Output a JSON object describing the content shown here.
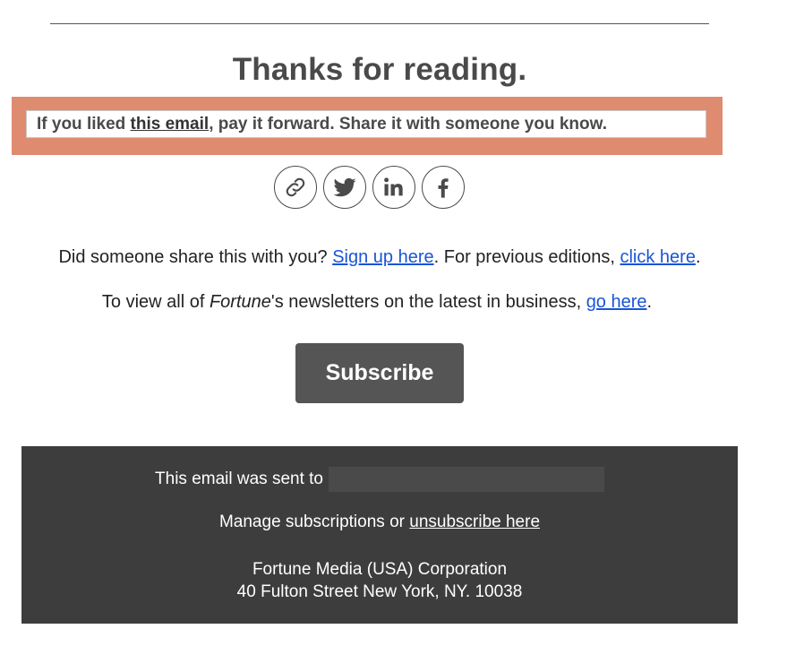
{
  "heading": "Thanks for reading.",
  "share_prompt": {
    "prefix": "If you liked ",
    "link": "this email",
    "suffix": ", pay it forward. Share it with someone you know."
  },
  "social_buttons": [
    {
      "icon": "link-icon"
    },
    {
      "icon": "twitter-icon"
    },
    {
      "icon": "linkedin-icon"
    },
    {
      "icon": "facebook-icon"
    }
  ],
  "signup_line": {
    "prefix": "Did someone share this with you? ",
    "signup_link": "Sign up here",
    "middle": ". For previous editions, ",
    "editions_link": "click here",
    "suffix": "."
  },
  "newsletters_line": {
    "prefix": "To view all of ",
    "brand": "Fortune",
    "middle": "'s newsletters on the latest in business, ",
    "link": "go here",
    "suffix": "."
  },
  "subscribe_label": "Subscribe",
  "footer": {
    "sent_to_label": "This email was sent to",
    "manage_prefix": "Manage subscriptions or ",
    "unsubscribe_link": "unsubscribe here",
    "company": "Fortune Media (USA) Corporation",
    "address": "40 Fulton Street New York, NY. 10038"
  },
  "colors": {
    "share_box": "#df8b70",
    "link": "#1a55d6",
    "subscribe_bg": "#555555",
    "footer_bg": "#3d3d3d"
  }
}
